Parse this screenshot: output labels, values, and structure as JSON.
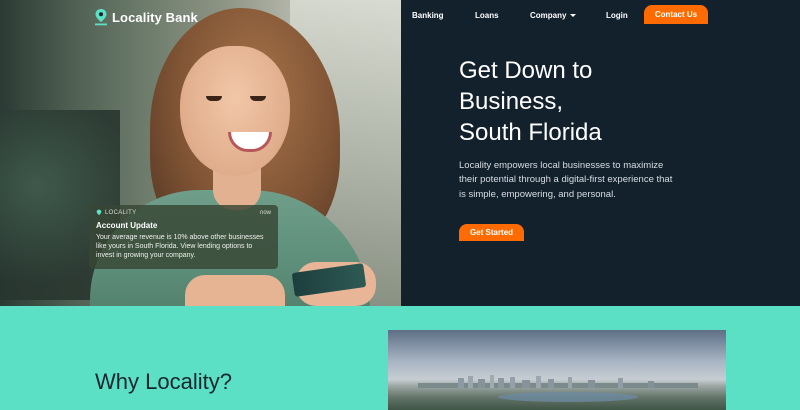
{
  "brand": {
    "name": "Locality Bank",
    "accent": "#5be0c6",
    "cta_color": "#ff6b00",
    "dark": "#13212d"
  },
  "nav": {
    "items": [
      {
        "label": "Banking"
      },
      {
        "label": "Loans"
      },
      {
        "label": "Company"
      },
      {
        "label": "Login"
      }
    ],
    "contact_label": "Contact Us"
  },
  "hero": {
    "headline_lines": [
      "Get Down to",
      "Business,",
      "South Florida"
    ],
    "subtext": "Locality empowers local businesses to maximize their potential through a digital-first experience that is simple, empowering, and personal.",
    "cta_label": "Get Started"
  },
  "notification": {
    "brand": "LOCALITY",
    "time": "now",
    "title": "Account Update",
    "body": "Your average revenue is 10% above other businesses like yours in South Florida. View lending options to invest in growing your company."
  },
  "why_section": {
    "title": "Why Locality?"
  },
  "icons": {
    "logo": "map-pin-icon",
    "dropdown": "caret-down-icon"
  }
}
